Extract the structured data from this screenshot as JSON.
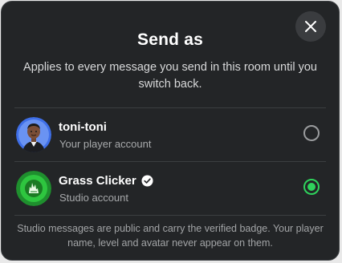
{
  "dialog": {
    "title": "Send as",
    "subtitle": "Applies to every message you send in this room until you switch back.",
    "close_icon": "close-icon",
    "footer": "Studio messages are public and carry the verified badge. Your player name, level and avatar never appear on them."
  },
  "accounts": [
    {
      "name": "toni-toni",
      "type": "Your player account",
      "selected": false,
      "verified": false,
      "avatar_icon": "player-avatar-icon"
    },
    {
      "name": "Grass Clicker",
      "type": "Studio account",
      "selected": true,
      "verified": true,
      "avatar_icon": "grass-clicker-logo-icon"
    }
  ],
  "colors": {
    "background": "#232527",
    "accent_green": "#2fd35c",
    "avatar_blue": "#3f6fe8"
  }
}
